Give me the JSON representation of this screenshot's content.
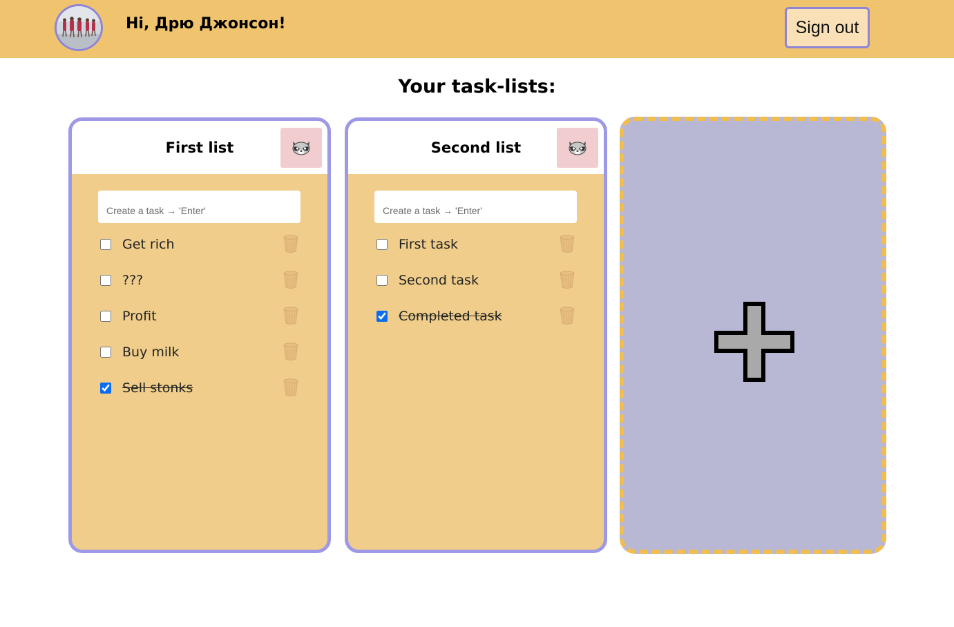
{
  "header": {
    "greeting": "Hi, Дрю Джонсон!",
    "signout_label": "Sign out",
    "accent_color": "#f0c46e",
    "border_color": "#8f84d6"
  },
  "page_title": "Your task-lists:",
  "lists": [
    {
      "title": "First list",
      "menu_icon": "raccoon-icon",
      "input_placeholder": "Create a task → 'Enter'",
      "tasks": [
        {
          "label": "Get rich",
          "done": false
        },
        {
          "label": "???",
          "done": false
        },
        {
          "label": "Profit",
          "done": false
        },
        {
          "label": "Buy milk",
          "done": false
        },
        {
          "label": "Sell stonks",
          "done": true
        }
      ]
    },
    {
      "title": "Second list",
      "menu_icon": "raccoon-icon",
      "input_placeholder": "Create a task → 'Enter'",
      "tasks": [
        {
          "label": "First task",
          "done": false
        },
        {
          "label": "Second task",
          "done": false
        },
        {
          "label": "Completed task",
          "done": true
        }
      ]
    }
  ],
  "add_list": {
    "icon": "plus-icon",
    "background": "#b8b7d4",
    "border_color": "#f1bd4f"
  },
  "colors": {
    "card_border": "#9d99e6",
    "card_body": "#f0cd8a",
    "raccoon_button": "#f1cdd0"
  }
}
